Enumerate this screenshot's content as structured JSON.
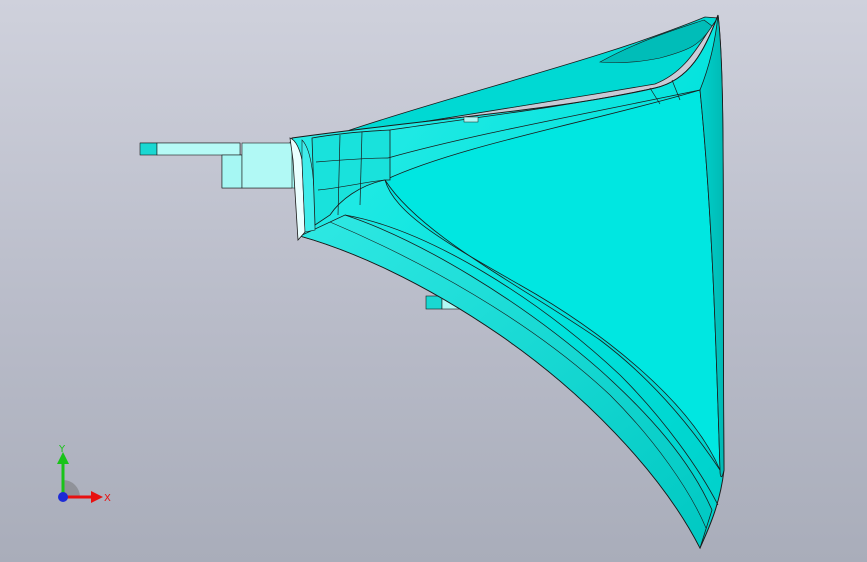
{
  "viewport": {
    "background_top": "#cfd1dc",
    "background_bottom": "#a9adba"
  },
  "model": {
    "face_color": "#00e5df",
    "face_shadow": "#00c2bd",
    "face_highlight": "#5ff3ef",
    "flat_face_color": "#a6f7f3",
    "edge_color": "#1a1a1a"
  },
  "triad": {
    "x_label": "X",
    "y_label": "Y",
    "x_color": "#e81010",
    "y_color": "#19c319",
    "z_color": "#1d2bd6"
  }
}
